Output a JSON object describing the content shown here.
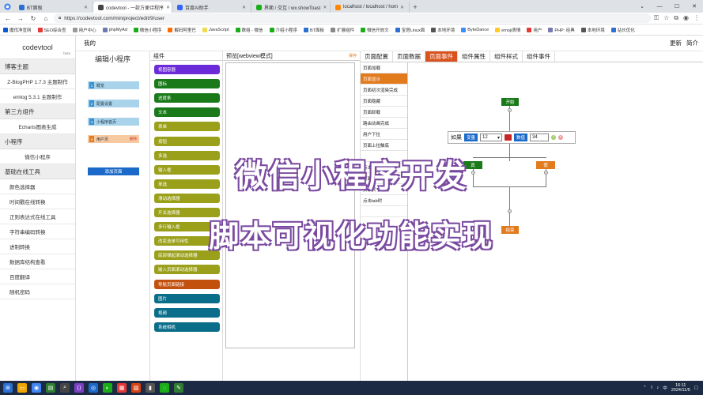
{
  "browser": {
    "tabs": [
      {
        "label": "BT面板",
        "color": "#2a6fd1",
        "active": false
      },
      {
        "label": "codevtool - 一款方便诗程序",
        "color": "#444444",
        "active": true
      },
      {
        "label": "百度AI助手",
        "color": "#3366ff",
        "active": false
      },
      {
        "label": "界面 / 交互 / wx.showToast",
        "color": "#1aad19",
        "active": false
      },
      {
        "label": "localhost / localhost / hom",
        "color": "#ff8800",
        "active": false
      }
    ],
    "url": "https://codevtool.com/miniproject/edit/9/user",
    "bookmarks": [
      {
        "label": "魔伐净宣网",
        "color": "#0b57d0"
      },
      {
        "label": "SEO综合查",
        "color": "#e53935"
      },
      {
        "label": "用户中心",
        "color": "#999999"
      },
      {
        "label": "phpMyAd",
        "color": "#6c78af"
      },
      {
        "label": "微信小程序",
        "color": "#1aad19"
      },
      {
        "label": "解码阿里巴",
        "color": "#ff6a00"
      },
      {
        "label": "JavaScript",
        "color": "#f0db4f"
      },
      {
        "label": "数组 - 微信",
        "color": "#1aad19"
      },
      {
        "label": "介绍小程序",
        "color": "#1aad19"
      },
      {
        "label": "BT面板",
        "color": "#2a6fd1"
      },
      {
        "label": "扩展组件",
        "color": "#888888"
      },
      {
        "label": "微信开放文",
        "color": "#1aad19"
      },
      {
        "label": "宝塔Linux面",
        "color": "#2a6fd1"
      },
      {
        "label": "本地环境",
        "color": "#555555"
      },
      {
        "label": "ByteDance",
        "color": "#3c8cff"
      },
      {
        "label": "emoji表情",
        "color": "#ffca28"
      },
      {
        "label": "用户",
        "color": "#e53935"
      },
      {
        "label": "PHP: 经典",
        "color": "#777bb3"
      },
      {
        "label": "本地环境",
        "color": "#555555"
      },
      {
        "label": "站长优化",
        "color": "#2a6fd1"
      }
    ]
  },
  "sidebar": {
    "brand": "codevtool",
    "beta": "beta",
    "sections": [
      {
        "title": "博客主题",
        "items": [
          "Z-BlogPHP 1.7.3 主题制作",
          "emlog 5.3.1 主题制作"
        ]
      },
      {
        "title": "第三方组件",
        "items": [
          "Echarts图表生成"
        ]
      },
      {
        "title": "小程序",
        "items": [
          "微信小程序"
        ]
      },
      {
        "title": "基础在线工具",
        "items": [
          "颜色选择器",
          "时间戳在线转换",
          "正则表达式在线工具",
          "字符串编码转换",
          "进制转换",
          "数据库结构查看",
          "百度翻译",
          "随机密码"
        ]
      }
    ]
  },
  "topbar": {
    "my": "我的",
    "update": "更新",
    "profile": "简介"
  },
  "editor": {
    "title": "编辑小程序",
    "pages": [
      {
        "num": "1",
        "label": "概览"
      },
      {
        "num": "2",
        "label": "配置设置"
      },
      {
        "num": "3",
        "label": "小程序首页"
      }
    ],
    "user_page": {
      "num": "4",
      "label": "用户页",
      "delete": "删除"
    },
    "add_page": "添加页面"
  },
  "components": {
    "header": "组件",
    "items": [
      {
        "label": "视图容器",
        "color": "#6c2bd9"
      },
      {
        "label": "图标",
        "color": "#1a7a1a"
      },
      {
        "label": "进度条",
        "color": "#1a7a1a"
      },
      {
        "label": "文本",
        "color": "#1a7a1a"
      },
      {
        "label": "表单",
        "color": "#9aa01a"
      },
      {
        "label": "按钮",
        "color": "#9aa01a"
      },
      {
        "label": "多选",
        "color": "#9aa01a"
      },
      {
        "label": "输入框",
        "color": "#9aa01a"
      },
      {
        "label": "单选",
        "color": "#9aa01a"
      },
      {
        "label": "滑动选择器",
        "color": "#9aa01a"
      },
      {
        "label": "开关选择器",
        "color": "#9aa01a"
      },
      {
        "label": "多行输入框",
        "color": "#9aa01a"
      },
      {
        "label": "改变选单可用性",
        "color": "#9aa01a"
      },
      {
        "label": "底部弹起滚动选择器",
        "color": "#9aa01a"
      },
      {
        "label": "嵌入页面滚动选择器",
        "color": "#9aa01a"
      },
      {
        "label": "导航页面链接",
        "color": "#c2510e"
      },
      {
        "label": "图片",
        "color": "#0a6e8a"
      },
      {
        "label": "视频",
        "color": "#0a6e8a"
      },
      {
        "label": "系统相机",
        "color": "#0a6e8a"
      }
    ]
  },
  "preview": {
    "header": "预览[webview模式]",
    "save": "保存"
  },
  "right_tabs": [
    "页面配置",
    "页面数据",
    "页面事件",
    "组件属性",
    "组件样式",
    "组件事件"
  ],
  "active_tab": "页面事件",
  "events": {
    "items": [
      "页面加载",
      "页面显示",
      "页面初次渲染完成",
      "页面隐藏",
      "页面卸载",
      "路由动画完成",
      "用户下拉",
      "页面上拉触底",
      "",
      "点击右上角转发",
      "页面滚动",
      "页面尺寸改变",
      "点击tab时",
      ""
    ],
    "active_index": 1
  },
  "flow": {
    "start": "开始",
    "end": "结束",
    "true_label": "真",
    "false_label": "假",
    "condition": {
      "if": "如果",
      "var": "变量",
      "var_value": "12",
      "value_label": "数值",
      "value": "34"
    }
  },
  "overlay": {
    "line1": "微信小程序开发",
    "line2": "脚本可视化功能实现"
  },
  "taskbar": {
    "time": "16:11",
    "date": "2024/11/5",
    "lang": "中"
  }
}
